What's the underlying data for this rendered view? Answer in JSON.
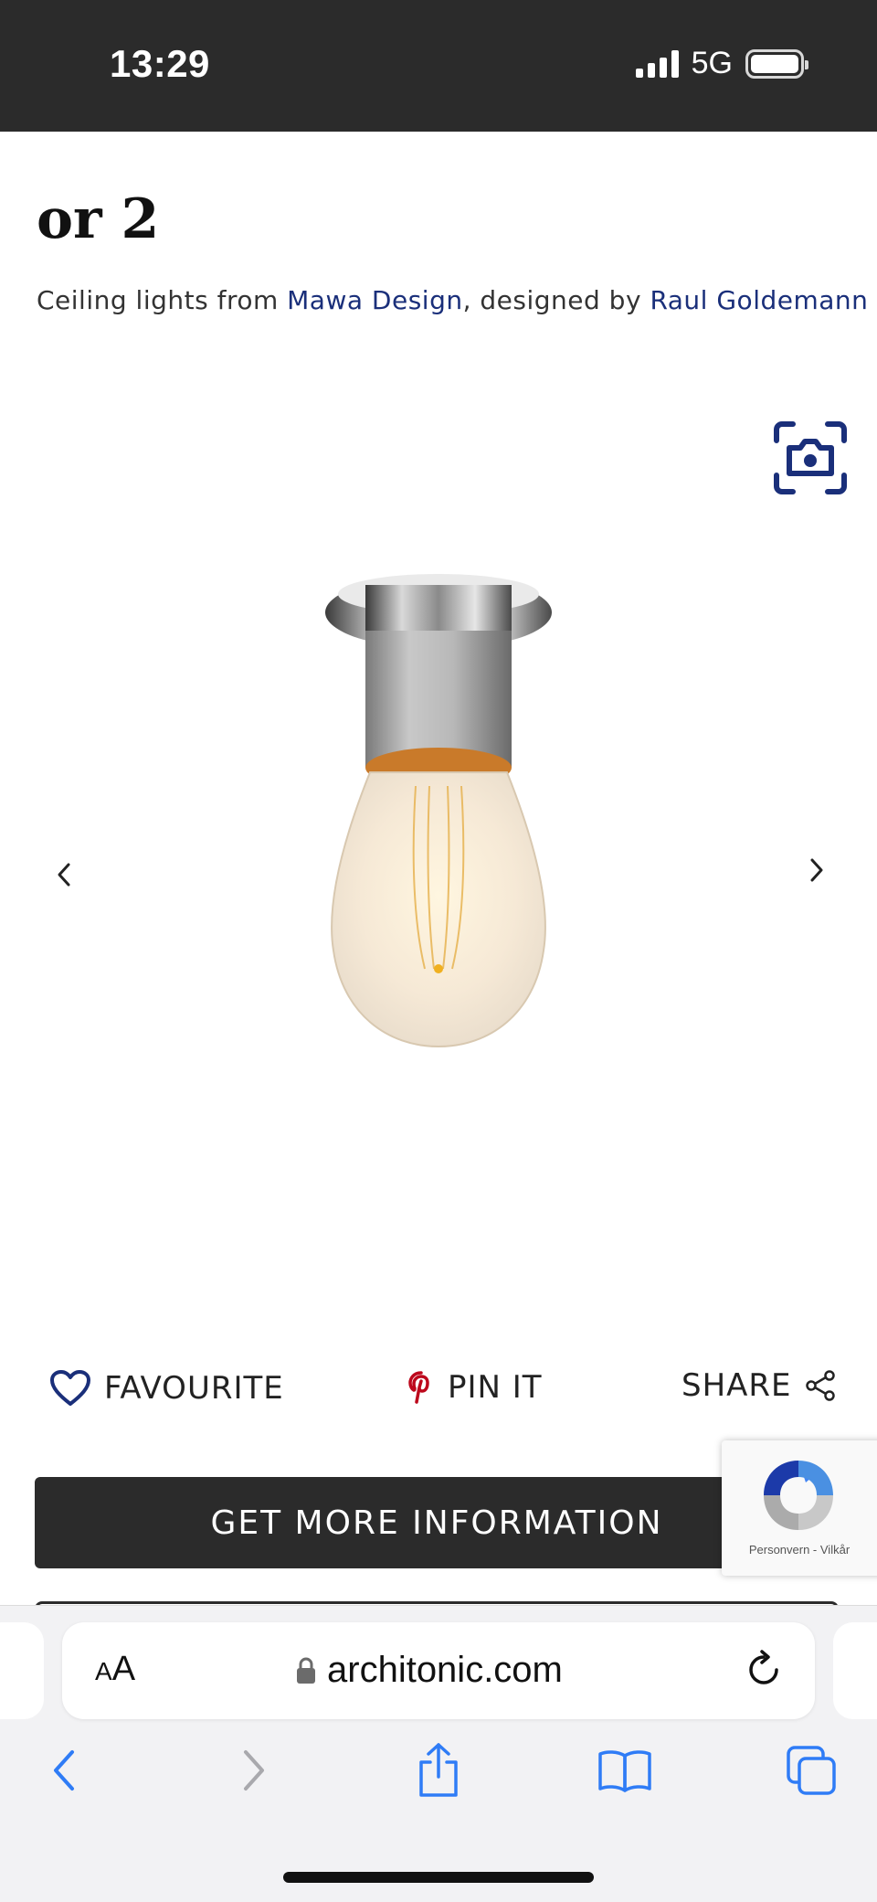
{
  "status_bar": {
    "time": "13:29",
    "network": "5G"
  },
  "product": {
    "title": "or 2",
    "subtitle_prefix": "Ceiling lights from ",
    "manufacturer": "Mawa Design",
    "subtitle_middle": ", designed by ",
    "designer": "Raul Goldemann"
  },
  "actions": {
    "favourite": "FAVOURITE",
    "pin": "PIN IT",
    "share": "SHARE"
  },
  "cta": {
    "label": "GET MORE INFORMATION"
  },
  "recaptcha": {
    "text": "Personvern - Vilkår"
  },
  "browser": {
    "text_size_label_small": "A",
    "text_size_label_large": "A",
    "url": "architonic.com"
  },
  "colors": {
    "link": "#1a2f7a",
    "dark": "#2b2b2b",
    "pinterest": "#bd081c",
    "ios_blue": "#2f7cf6"
  },
  "icons": [
    "camera-search-icon",
    "chevron-left-icon",
    "chevron-right-icon",
    "heart-icon",
    "pinterest-icon",
    "share-icon",
    "lock-icon",
    "reload-icon",
    "back-icon",
    "forward-icon",
    "share-sheet-icon",
    "bookmarks-icon",
    "tabs-icon"
  ]
}
